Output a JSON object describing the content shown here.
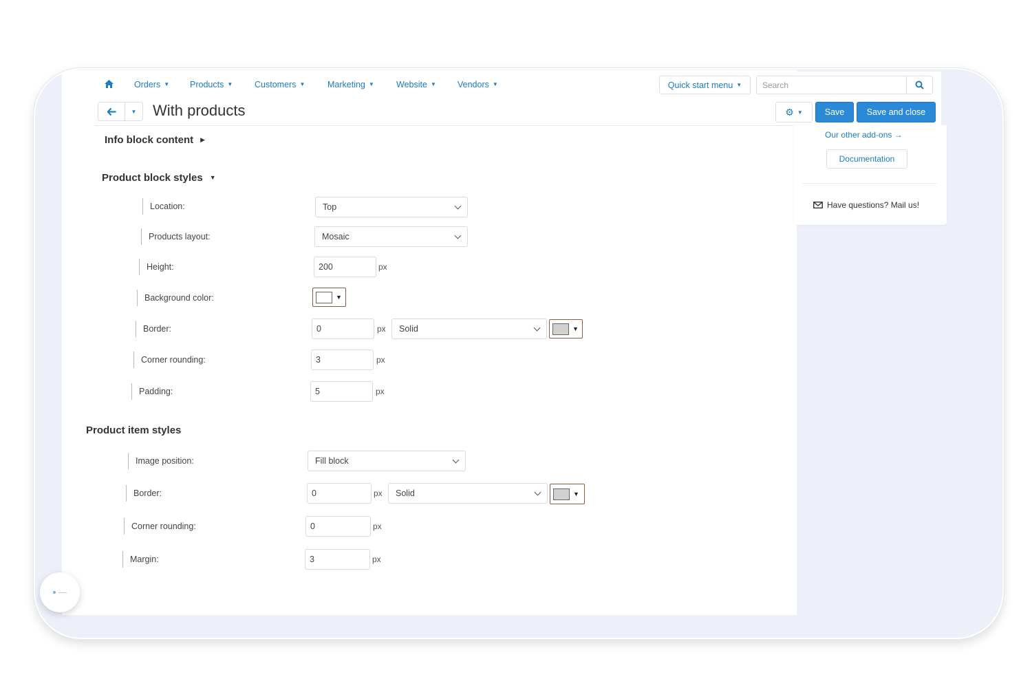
{
  "nav": {
    "items": [
      "Orders",
      "Products",
      "Customers",
      "Marketing",
      "Website",
      "Vendors"
    ],
    "quick_start": "Quick start menu",
    "search_placeholder": "Search"
  },
  "page": {
    "title": "With products",
    "save_label": "Save",
    "save_close_label": "Save and close"
  },
  "sidebar": {
    "addons_link": "Our other add-ons →",
    "documentation": "Documentation",
    "mail": "Have questions? Mail us!"
  },
  "info_block": {
    "title": "Info block content"
  },
  "product_block_styles": {
    "title": "Product block styles",
    "location": {
      "label": "Location:",
      "value": "Top"
    },
    "layout": {
      "label": "Products layout:",
      "value": "Mosaic"
    },
    "height": {
      "label": "Height:",
      "value": "200",
      "unit": "px"
    },
    "background": {
      "label": "Background color:",
      "color": "#ffffff"
    },
    "border": {
      "label": "Border:",
      "value": "0",
      "unit": "px",
      "style": "Solid",
      "color": "#d0d0d0"
    },
    "rounding": {
      "label": "Corner rounding:",
      "value": "3",
      "unit": "px"
    },
    "padding": {
      "label": "Padding:",
      "value": "5",
      "unit": "px"
    }
  },
  "product_item_styles": {
    "title": "Product item styles",
    "image_position": {
      "label": "Image position:",
      "value": "Fill block"
    },
    "border": {
      "label": "Border:",
      "value": "0",
      "unit": "px",
      "style": "Solid",
      "color": "#d0d0d0"
    },
    "rounding": {
      "label": "Corner rounding:",
      "value": "0",
      "unit": "px"
    },
    "margin": {
      "label": "Margin:",
      "value": "3",
      "unit": "px"
    }
  },
  "colors": {
    "accent": "#2a8ad8",
    "link": "#1e7cc2"
  },
  "icons": [
    "home-icon",
    "search-icon",
    "arrow-left-icon",
    "gear-icon",
    "envelope-icon"
  ]
}
